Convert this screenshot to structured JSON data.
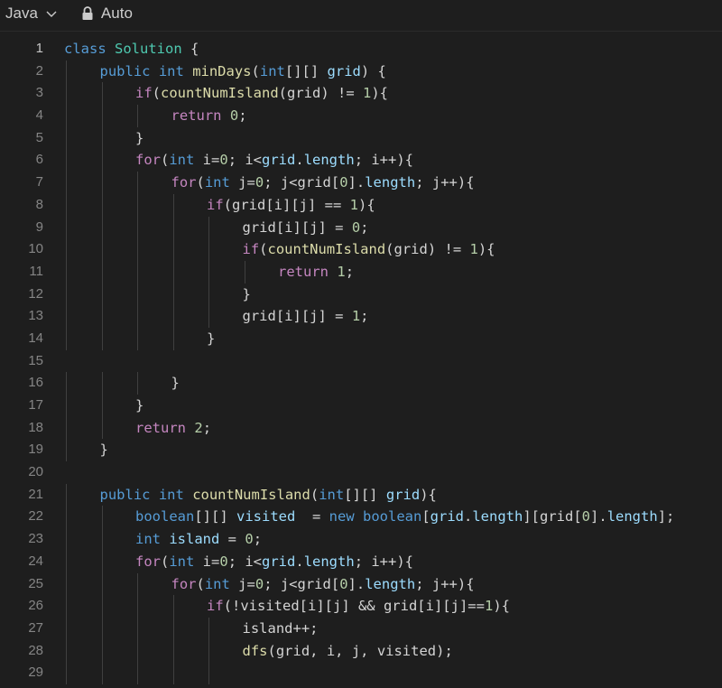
{
  "toolbar": {
    "language": "Java",
    "mode": "Auto",
    "chevron_icon": "chevron-down-icon",
    "lock_icon": "lock-icon"
  },
  "colors": {
    "background": "#1e1e1e",
    "keyword": "#569cd6",
    "control": "#c586c0",
    "class": "#4ec9b0",
    "function": "#dcdcaa",
    "variable": "#9cdcfe",
    "number": "#b5cea8",
    "text": "#d4d4d4",
    "line_number": "#858585"
  },
  "editor": {
    "lines": [
      {
        "n": "1",
        "indent": 0,
        "tokens": [
          [
            "class",
            "kw"
          ],
          [
            " ",
            "op"
          ],
          [
            "Solution",
            "cls"
          ],
          [
            " {",
            "op"
          ]
        ]
      },
      {
        "n": "2",
        "indent": 1,
        "tokens": [
          [
            "public",
            "kw"
          ],
          [
            " ",
            "op"
          ],
          [
            "int",
            "kw"
          ],
          [
            " ",
            "op"
          ],
          [
            "minDays",
            "fn"
          ],
          [
            "(",
            "op"
          ],
          [
            "int",
            "kw"
          ],
          [
            "[][] ",
            "op"
          ],
          [
            "grid",
            "var"
          ],
          [
            ") {",
            "op"
          ]
        ]
      },
      {
        "n": "3",
        "indent": 2,
        "tokens": [
          [
            "if",
            "ctl"
          ],
          [
            "(",
            "op"
          ],
          [
            "countNumIsland",
            "fn"
          ],
          [
            "(grid) != ",
            "op"
          ],
          [
            "1",
            "num"
          ],
          [
            "){",
            "op"
          ]
        ]
      },
      {
        "n": "4",
        "indent": 3,
        "tokens": [
          [
            "return",
            "ctl"
          ],
          [
            " ",
            "op"
          ],
          [
            "0",
            "num"
          ],
          [
            ";",
            "op"
          ]
        ]
      },
      {
        "n": "5",
        "indent": 2,
        "tokens": [
          [
            "}",
            "op"
          ]
        ]
      },
      {
        "n": "6",
        "indent": 2,
        "tokens": [
          [
            "for",
            "ctl"
          ],
          [
            "(",
            "op"
          ],
          [
            "int",
            "kw"
          ],
          [
            " i=",
            "op"
          ],
          [
            "0",
            "num"
          ],
          [
            "; i<",
            "op"
          ],
          [
            "grid",
            "var"
          ],
          [
            ".",
            "op"
          ],
          [
            "length",
            "var"
          ],
          [
            "; i++){",
            "op"
          ]
        ]
      },
      {
        "n": "7",
        "indent": 3,
        "tokens": [
          [
            "for",
            "ctl"
          ],
          [
            "(",
            "op"
          ],
          [
            "int",
            "kw"
          ],
          [
            " j=",
            "op"
          ],
          [
            "0",
            "num"
          ],
          [
            "; j<grid[",
            "op"
          ],
          [
            "0",
            "num"
          ],
          [
            "].",
            "op"
          ],
          [
            "length",
            "var"
          ],
          [
            "; j++){",
            "op"
          ]
        ]
      },
      {
        "n": "8",
        "indent": 4,
        "tokens": [
          [
            "if",
            "ctl"
          ],
          [
            "(grid[i][j] == ",
            "op"
          ],
          [
            "1",
            "num"
          ],
          [
            "){",
            "op"
          ]
        ]
      },
      {
        "n": "9",
        "indent": 5,
        "tokens": [
          [
            "grid[i][j] = ",
            "op"
          ],
          [
            "0",
            "num"
          ],
          [
            ";",
            "op"
          ]
        ]
      },
      {
        "n": "10",
        "indent": 5,
        "tokens": [
          [
            "if",
            "ctl"
          ],
          [
            "(",
            "op"
          ],
          [
            "countNumIsland",
            "fn"
          ],
          [
            "(grid) != ",
            "op"
          ],
          [
            "1",
            "num"
          ],
          [
            "){",
            "op"
          ]
        ]
      },
      {
        "n": "11",
        "indent": 6,
        "tokens": [
          [
            "return",
            "ctl"
          ],
          [
            " ",
            "op"
          ],
          [
            "1",
            "num"
          ],
          [
            ";",
            "op"
          ]
        ]
      },
      {
        "n": "12",
        "indent": 5,
        "tokens": [
          [
            "}",
            "op"
          ]
        ]
      },
      {
        "n": "13",
        "indent": 5,
        "tokens": [
          [
            "grid[i][j] = ",
            "op"
          ],
          [
            "1",
            "num"
          ],
          [
            ";",
            "op"
          ]
        ]
      },
      {
        "n": "14",
        "indent": 4,
        "tokens": [
          [
            "}",
            "op"
          ]
        ]
      },
      {
        "n": "15",
        "indent": 0,
        "tokens": []
      },
      {
        "n": "16",
        "indent": 3,
        "tokens": [
          [
            "}",
            "op"
          ]
        ]
      },
      {
        "n": "17",
        "indent": 2,
        "tokens": [
          [
            "}",
            "op"
          ]
        ]
      },
      {
        "n": "18",
        "indent": 2,
        "tokens": [
          [
            "return",
            "ctl"
          ],
          [
            " ",
            "op"
          ],
          [
            "2",
            "num"
          ],
          [
            ";",
            "op"
          ]
        ]
      },
      {
        "n": "19",
        "indent": 1,
        "tokens": [
          [
            "}",
            "op"
          ]
        ]
      },
      {
        "n": "20",
        "indent": 0,
        "tokens": []
      },
      {
        "n": "21",
        "indent": 1,
        "tokens": [
          [
            "public",
            "kw"
          ],
          [
            " ",
            "op"
          ],
          [
            "int",
            "kw"
          ],
          [
            " ",
            "op"
          ],
          [
            "countNumIsland",
            "fn"
          ],
          [
            "(",
            "op"
          ],
          [
            "int",
            "kw"
          ],
          [
            "[][] ",
            "op"
          ],
          [
            "grid",
            "var"
          ],
          [
            "){",
            "op"
          ]
        ]
      },
      {
        "n": "22",
        "indent": 2,
        "tokens": [
          [
            "boolean",
            "kw"
          ],
          [
            "[][] ",
            "op"
          ],
          [
            "visited",
            "var"
          ],
          [
            "  = ",
            "op"
          ],
          [
            "new",
            "kw"
          ],
          [
            " ",
            "op"
          ],
          [
            "boolean",
            "kw"
          ],
          [
            "[",
            "op"
          ],
          [
            "grid",
            "var"
          ],
          [
            ".",
            "op"
          ],
          [
            "length",
            "var"
          ],
          [
            "][grid[",
            "op"
          ],
          [
            "0",
            "num"
          ],
          [
            "].",
            "op"
          ],
          [
            "length",
            "var"
          ],
          [
            "];",
            "op"
          ]
        ]
      },
      {
        "n": "23",
        "indent": 2,
        "tokens": [
          [
            "int",
            "kw"
          ],
          [
            " ",
            "op"
          ],
          [
            "island",
            "var"
          ],
          [
            " = ",
            "op"
          ],
          [
            "0",
            "num"
          ],
          [
            ";",
            "op"
          ]
        ]
      },
      {
        "n": "24",
        "indent": 2,
        "tokens": [
          [
            "for",
            "ctl"
          ],
          [
            "(",
            "op"
          ],
          [
            "int",
            "kw"
          ],
          [
            " i=",
            "op"
          ],
          [
            "0",
            "num"
          ],
          [
            "; i<",
            "op"
          ],
          [
            "grid",
            "var"
          ],
          [
            ".",
            "op"
          ],
          [
            "length",
            "var"
          ],
          [
            "; i++){",
            "op"
          ]
        ]
      },
      {
        "n": "25",
        "indent": 3,
        "tokens": [
          [
            "for",
            "ctl"
          ],
          [
            "(",
            "op"
          ],
          [
            "int",
            "kw"
          ],
          [
            " j=",
            "op"
          ],
          [
            "0",
            "num"
          ],
          [
            "; j<grid[",
            "op"
          ],
          [
            "0",
            "num"
          ],
          [
            "].",
            "op"
          ],
          [
            "length",
            "var"
          ],
          [
            "; j++){",
            "op"
          ]
        ]
      },
      {
        "n": "26",
        "indent": 4,
        "tokens": [
          [
            "if",
            "ctl"
          ],
          [
            "(!visited[i][j] && grid[i][j]==",
            "op"
          ],
          [
            "1",
            "num"
          ],
          [
            "){",
            "op"
          ]
        ]
      },
      {
        "n": "27",
        "indent": 5,
        "tokens": [
          [
            "island++;",
            "op"
          ]
        ]
      },
      {
        "n": "28",
        "indent": 5,
        "tokens": [
          [
            "dfs",
            "fn"
          ],
          [
            "(grid, i, j, visited);",
            "op"
          ]
        ]
      },
      {
        "n": "29",
        "indent": 0,
        "guides": 5,
        "tokens": []
      }
    ]
  }
}
